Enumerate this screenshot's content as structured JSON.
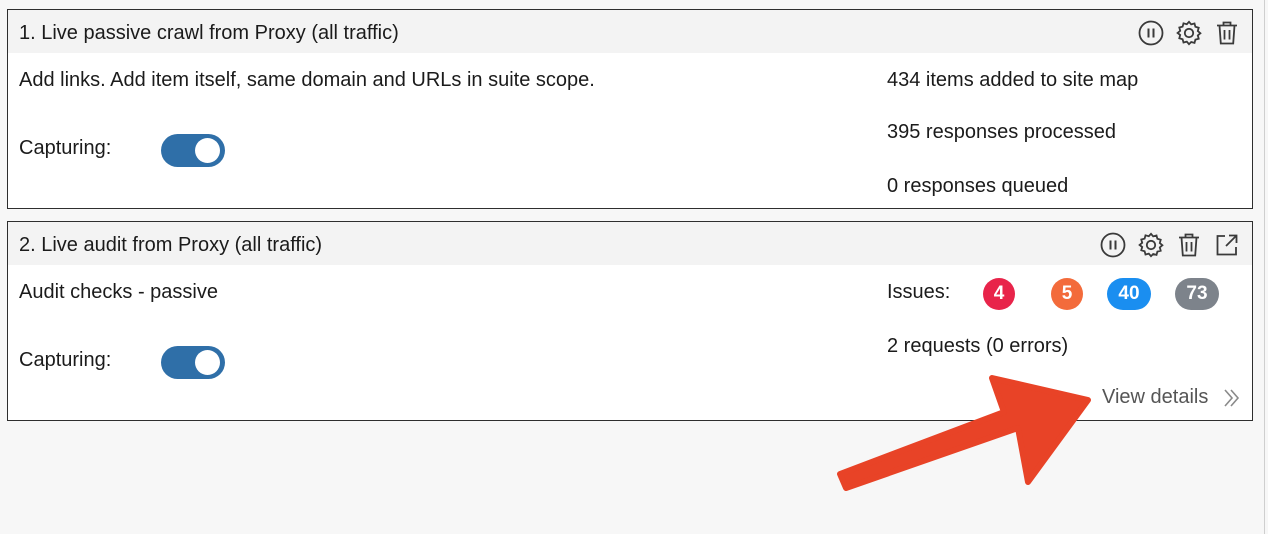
{
  "tasks": [
    {
      "title": "1.  Live passive crawl from Proxy (all traffic)",
      "description": "Add links. Add item itself, same domain and URLs in suite scope.",
      "capturing_label": "Capturing:",
      "capturing_on": true,
      "stats": [
        "434 items added to site map",
        "395 responses processed",
        "0 responses queued"
      ],
      "icons": [
        "pause-icon",
        "gear-icon",
        "trash-icon"
      ]
    },
    {
      "title": "2.  Live audit from Proxy (all traffic)",
      "description": "Audit checks - passive",
      "capturing_label": "Capturing:",
      "capturing_on": true,
      "issues_label": "Issues:",
      "issues": [
        {
          "value": "4",
          "severity": "high",
          "color": "#e8244a"
        },
        {
          "value": "5",
          "severity": "medium",
          "color": "#f36b3b"
        },
        {
          "value": "40",
          "severity": "low",
          "color": "#1a8ef0"
        },
        {
          "value": "73",
          "severity": "info",
          "color": "#7d838b"
        }
      ],
      "requests": "2 requests (0 errors)",
      "view_details": "View details",
      "icons": [
        "pause-icon",
        "gear-icon",
        "trash-icon",
        "external-link-icon"
      ]
    }
  ],
  "colors": {
    "toggle_on": "#2f6fa8",
    "annotation_arrow": "#e84327"
  }
}
